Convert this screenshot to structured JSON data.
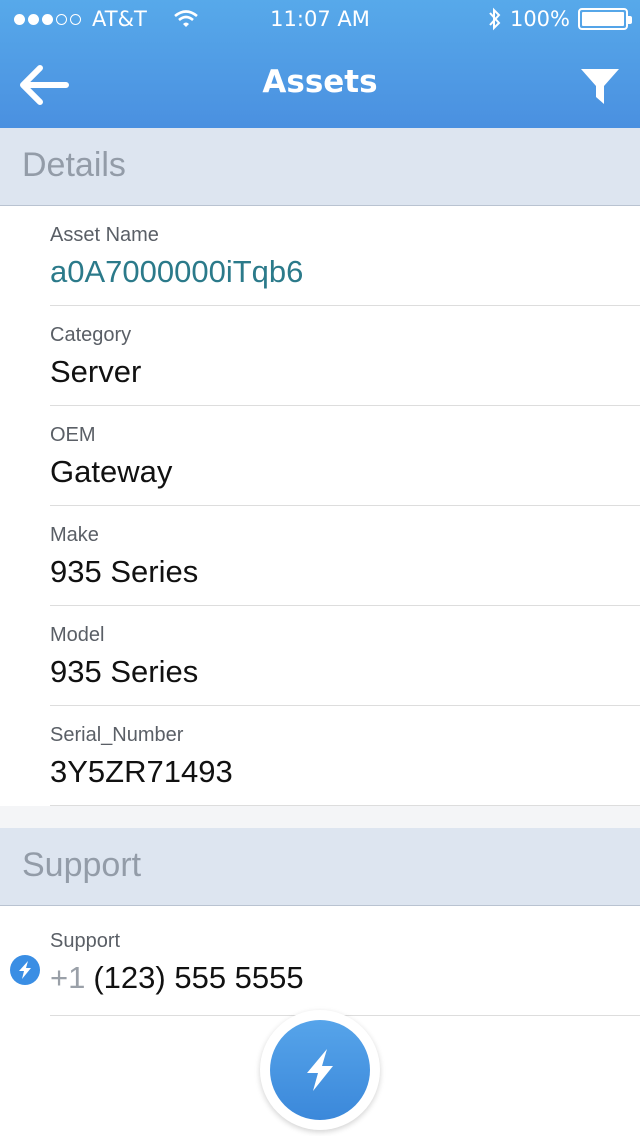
{
  "status_bar": {
    "carrier": "AT&T",
    "time": "11:07 AM",
    "battery": "100%",
    "signal_icon": "signal-dots-icon",
    "wifi_icon": "wifi-icon",
    "bluetooth_icon": "bluetooth-icon"
  },
  "nav": {
    "title": "Assets",
    "back_icon": "back-arrow-icon",
    "filter_icon": "filter-icon"
  },
  "details": {
    "heading": "Details",
    "fields": [
      {
        "label": "Asset Name",
        "value": "a0A7000000iTqb6"
      },
      {
        "label": "Category",
        "value": "Server"
      },
      {
        "label": "OEM",
        "value": "Gateway"
      },
      {
        "label": "Make",
        "value": "935 Series"
      },
      {
        "label": "Model",
        "value": "935 Series"
      },
      {
        "label": "Serial_Number",
        "value": "3Y5ZR71493"
      }
    ]
  },
  "support": {
    "heading": "Support",
    "label": "Support",
    "phone_prefix": "+1",
    "phone_number": "(123) 555 5555",
    "action_icon": "lightning-icon"
  },
  "fab": {
    "icon": "lightning-icon"
  },
  "colors": {
    "header": "#4a90e0",
    "section_header": "#dde5f0",
    "link": "#2b7a8a",
    "accent": "#3b88da"
  }
}
